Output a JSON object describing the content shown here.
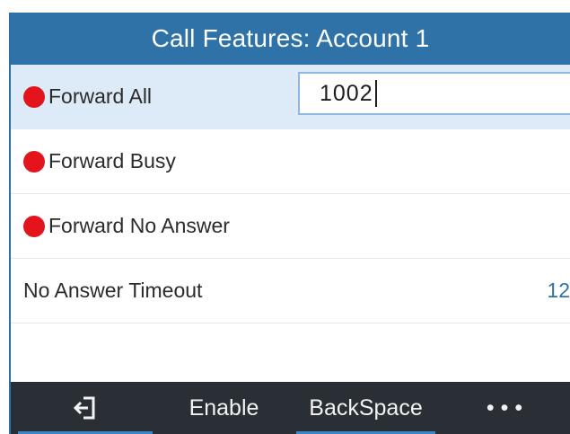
{
  "header": {
    "title": "Call Features: Account  1"
  },
  "rows": [
    {
      "label": "Forward All",
      "status": "enabled-red-dot",
      "value": "1002"
    },
    {
      "label": "Forward Busy",
      "status": "enabled-red-dot"
    },
    {
      "label": "Forward No Answer",
      "status": "enabled-red-dot"
    },
    {
      "label": "No Answer Timeout",
      "value": "12"
    }
  ],
  "softkeys": {
    "back_icon": "back-exit-icon",
    "enable": "Enable",
    "backspace": "BackSpace",
    "more": "• • •"
  },
  "colors": {
    "title_bar": "#2f72a8",
    "selected_row": "#dcebf7",
    "status_dot": "#e3141b",
    "softkey_bar": "#2a2f35",
    "accent": "#3b86c6"
  }
}
